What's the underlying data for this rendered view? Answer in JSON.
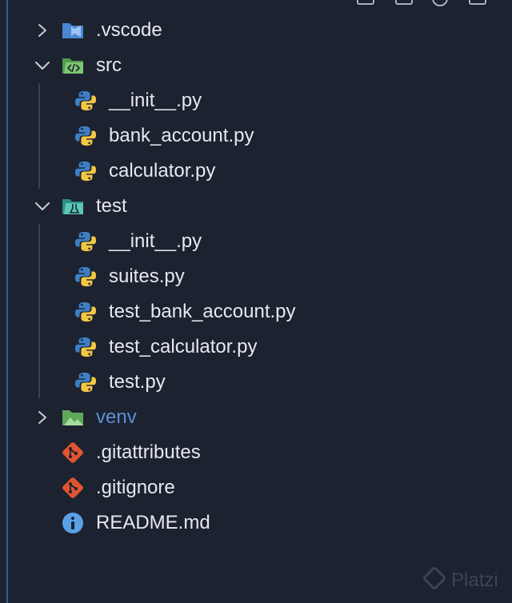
{
  "explorer": {
    "items": [
      {
        "label": "__init__.py"
      },
      {
        "label": "bank_account.py"
      },
      {
        "label": "calculator.py"
      },
      {
        "label": "__init__.py"
      },
      {
        "label": "suites.py"
      },
      {
        "label": "test_bank_account.py"
      },
      {
        "label": "test_calculator.py"
      },
      {
        "label": "test.py"
      }
    ],
    "folders": {
      "vscode": {
        "label": ".vscode",
        "expanded": false,
        "icon": "vscode-folder-icon"
      },
      "src": {
        "label": "src",
        "expanded": true,
        "icon": "source-folder-icon"
      },
      "test": {
        "label": "test",
        "expanded": true,
        "icon": "test-folder-icon"
      },
      "venv": {
        "label": "venv",
        "expanded": false,
        "icon": "venv-folder-icon"
      }
    },
    "files": {
      "gitattributes": {
        "label": ".gitattributes",
        "icon": "git-icon"
      },
      "gitignore": {
        "label": ".gitignore",
        "icon": "git-icon"
      },
      "readme": {
        "label": "README.md",
        "icon": "info-icon"
      }
    }
  },
  "watermark": {
    "text": "Platzi"
  },
  "colors": {
    "background": "#1c2230",
    "text": "#e6e9ef",
    "muted_folder": "#5d8fd6",
    "python_blue": "#3d7fc4",
    "python_yellow": "#f2c744",
    "git_red": "#e0542f",
    "info_blue": "#5aa0e6"
  }
}
